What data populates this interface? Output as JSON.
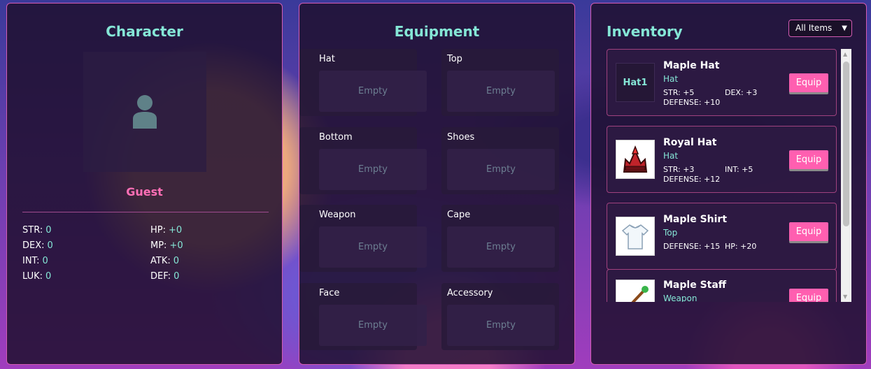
{
  "character": {
    "title": "Character",
    "name": "Guest",
    "avatar_icon": "user-icon",
    "stats": [
      {
        "label": "STR:",
        "value": "0"
      },
      {
        "label": "HP:",
        "value": "+0"
      },
      {
        "label": "DEX:",
        "value": "0"
      },
      {
        "label": "MP:",
        "value": "+0"
      },
      {
        "label": "INT:",
        "value": "0"
      },
      {
        "label": "ATK:",
        "value": "0"
      },
      {
        "label": "LUK:",
        "value": "0"
      },
      {
        "label": "DEF:",
        "value": "0"
      }
    ]
  },
  "equipment": {
    "title": "Equipment",
    "empty_label": "Empty",
    "slots": [
      "Hat",
      "Top",
      "Bottom",
      "Shoes",
      "Weapon",
      "Cape",
      "Face",
      "Accessory"
    ]
  },
  "inventory": {
    "title": "Inventory",
    "filter": "All Items",
    "equip_label": "Equip",
    "items": [
      {
        "name": "Maple Hat",
        "type": "Hat",
        "thumb_text": "Hat1",
        "icon": "maple-hat-icon",
        "stats": [
          "STR: +5",
          "DEX: +3",
          "DEFENSE: +10"
        ]
      },
      {
        "name": "Royal Hat",
        "type": "Hat",
        "icon": "royal-hat-icon",
        "stats": [
          "STR: +3",
          "INT: +5",
          "DEFENSE: +12"
        ]
      },
      {
        "name": "Maple Shirt",
        "type": "Top",
        "icon": "maple-shirt-icon",
        "stats": [
          "DEFENSE: +15",
          "HP: +20"
        ]
      },
      {
        "name": "Maple Staff",
        "type": "Weapon",
        "icon": "maple-staff-icon",
        "stats": []
      }
    ]
  },
  "colors": {
    "accent": "#85e6d6",
    "pink": "#ff5fb0",
    "border": "#d35bb3"
  }
}
